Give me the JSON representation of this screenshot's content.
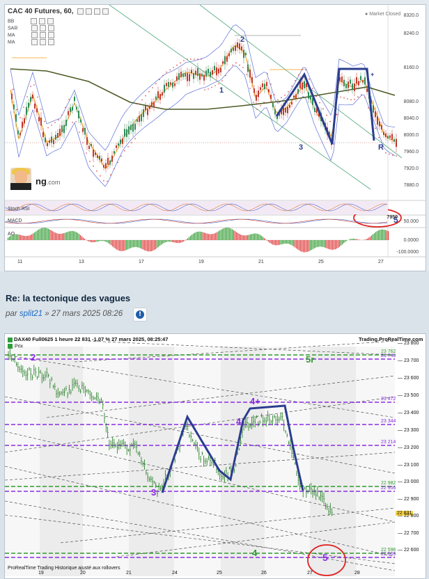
{
  "top_chart": {
    "title": "CAC 40 Futures, 60, ",
    "indicators": [
      "BB",
      "SAR",
      "MA",
      "MA"
    ],
    "market_status": "Market Closed",
    "price_axis": [
      "8240.0",
      "8160.0",
      "8080.0",
      "8040.0",
      "8000.0",
      "7960.0",
      "7920.0",
      "7880.0",
      "8320.0"
    ],
    "date_axis": [
      "11",
      "13",
      "17",
      "19",
      "21",
      "25",
      "27"
    ],
    "sub_labels": {
      "stoch": "Stoch RSI",
      "macd": "MACD",
      "ao": "AO"
    },
    "sub_values": {
      "macd_val": "7950",
      "macd_axis": "50.000",
      "ao_zero": "0.0000",
      "ao_min": "-100.0000"
    },
    "logo_text": "ng",
    "logo_suffix": ".com",
    "wave_labels": {
      "w1": "1",
      "w2": "2",
      "w3": "3",
      "w5": "5",
      "r": "R",
      "plus": "+"
    }
  },
  "post": {
    "title": "Re: la tectonique des vagues",
    "by": "par",
    "author": "split21",
    "date": "» 27 mars 2025 08:26",
    "quote_icon": "info-icon"
  },
  "bottom_chart": {
    "header": "DAX40 Full0625 1 heure 22 831 -1,07 % 27 mars 2025, 08:25:47",
    "site": "Trading.ProRealTime.com",
    "legend": "Prix",
    "footer": "ProRealTime Trading Historique ajusté aux rollovers",
    "y_axis": [
      "23 800",
      "23 700",
      "23 600",
      "23 500",
      "23 400",
      "23 300",
      "23 200",
      "23 100",
      "23 000",
      "22 900",
      "22 800",
      "22 700",
      "22 600"
    ],
    "levels": [
      "23 762",
      "23 740",
      "23 472",
      "23 344",
      "23 214",
      "22 982",
      "22 956",
      "22 596",
      "22 569"
    ],
    "last_price": "22 831",
    "x_axis": [
      "19",
      "20",
      "21",
      "24",
      "25",
      "26",
      "27",
      "28"
    ],
    "wave_labels": {
      "w2": "2",
      "w3": "3",
      "w4": "4",
      "w4plus": "4+",
      "w5": "5",
      "g4": "4",
      "g5": "5r"
    }
  },
  "colors": {
    "wave_blue": "#2b3d8f",
    "level_green": "#2e9a2e",
    "level_purple": "#8a2be2",
    "circle_red": "#e02020"
  }
}
